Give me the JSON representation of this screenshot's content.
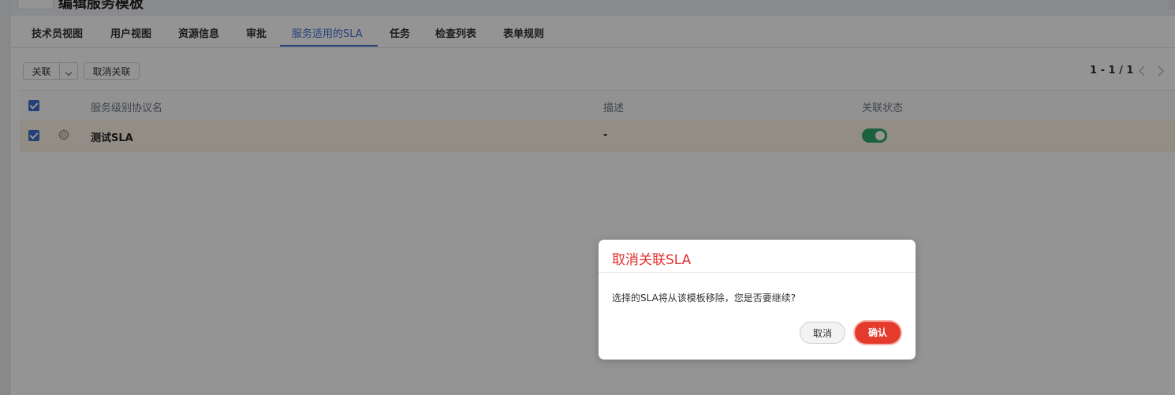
{
  "header": {
    "title": "编辑服务模板"
  },
  "tabs": [
    {
      "label": "技术员视图"
    },
    {
      "label": "用户视图"
    },
    {
      "label": "资源信息"
    },
    {
      "label": "审批"
    },
    {
      "label": "服务适用的SLA"
    },
    {
      "label": "任务"
    },
    {
      "label": "检查列表"
    },
    {
      "label": "表单规则"
    }
  ],
  "active_tab": "服务适用的SLA",
  "toolbar": {
    "link_label": "关联",
    "unlink_label": "取消关联"
  },
  "pager": {
    "range": "1 - 1 / 1"
  },
  "table": {
    "columns": [
      "服务级别协议名",
      "描述",
      "关联状态"
    ],
    "rows": [
      {
        "name": "测试SLA",
        "description": "-",
        "linked": true,
        "selected": true
      }
    ],
    "all_selected": true
  },
  "modal": {
    "title": "取消关联SLA",
    "message": "选择的SLA将从该模板移除，您是否要继续?",
    "cancel_label": "取消",
    "confirm_label": "确认"
  },
  "colors": {
    "accent": "#3f6fd1",
    "danger": "#e43b2c",
    "toggle_on": "#2fa869",
    "row_highlight": "#fef5e6"
  },
  "icons": {
    "row_action": "gear-icon",
    "dropdown": "chevron-down-icon",
    "prev": "chevron-left-icon",
    "next": "chevron-right-icon"
  }
}
